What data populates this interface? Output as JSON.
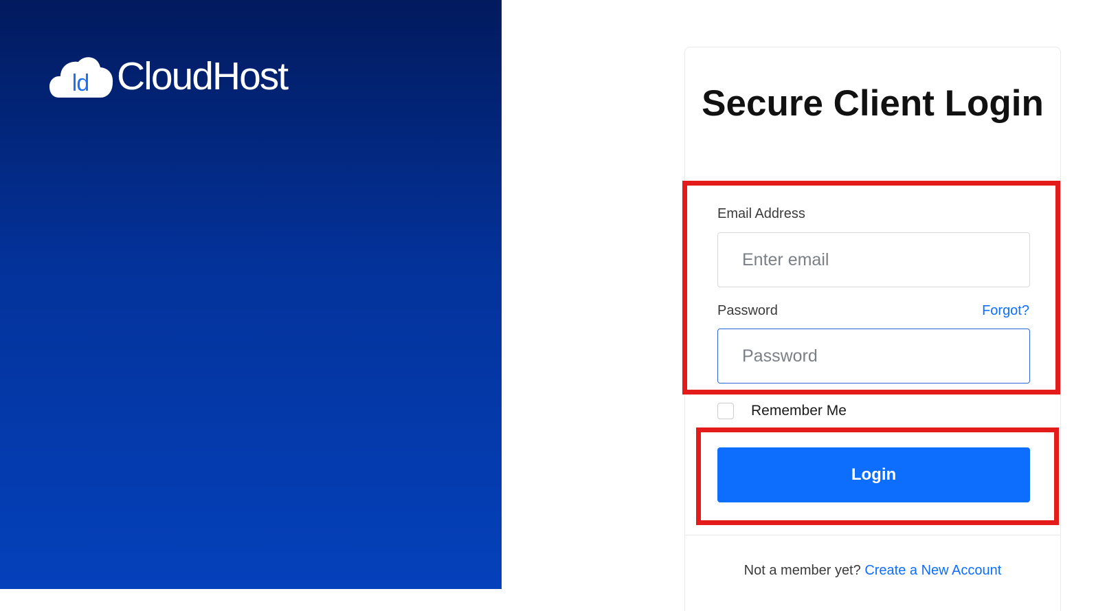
{
  "brand": {
    "logo_mark": "ld",
    "name": "CloudHost"
  },
  "login_card": {
    "title": "Secure Client Login",
    "email_label": "Email Address",
    "email_placeholder": "Enter email",
    "email_value": "",
    "password_label": "Password",
    "password_placeholder": "Password",
    "password_value": "",
    "forgot_link": "Forgot?",
    "remember_label": "Remember Me",
    "remember_checked": false,
    "login_button": "Login",
    "footer_prefix": "Not a member yet?",
    "footer_link": "Create a New Account"
  },
  "colors": {
    "left_panel_top": "#021a5e",
    "left_panel_bottom": "#0541bb",
    "accent": "#0d6efd",
    "highlight": "#e41b1b"
  }
}
